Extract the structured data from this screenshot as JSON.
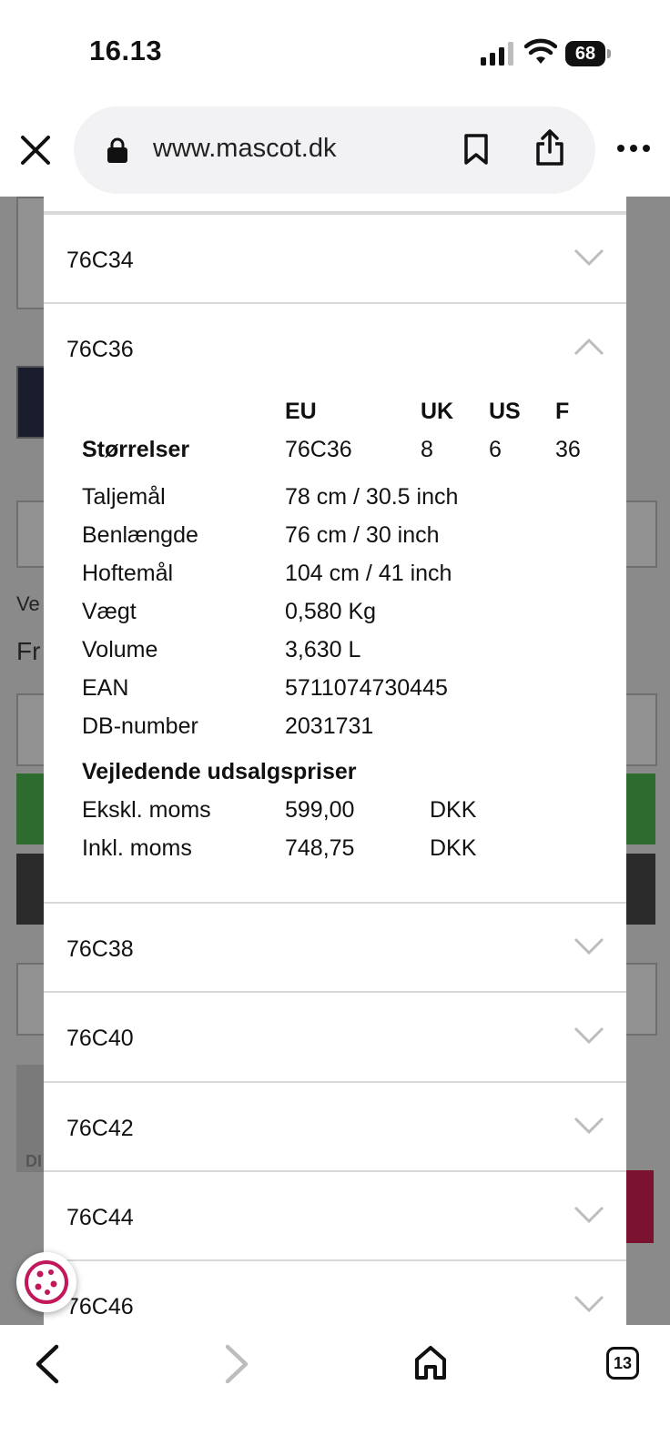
{
  "status_bar": {
    "time": "16.13",
    "battery": "68"
  },
  "browser": {
    "url": "www.mascot.dk",
    "tab_count": "13"
  },
  "accordion_before": [
    {
      "label": "76C34"
    }
  ],
  "expanded": {
    "label": "76C36",
    "headers": {
      "eu": "EU",
      "uk": "UK",
      "us": "US",
      "f": "F"
    },
    "sizes_row": {
      "label": "Størrelser",
      "eu": "76C36",
      "uk": "8",
      "us": "6",
      "f": "36"
    },
    "specs": [
      {
        "label": "Taljemål",
        "value": "78 cm / 30.5 inch"
      },
      {
        "label": "Benlængde",
        "value": "76 cm / 30 inch"
      },
      {
        "label": "Hoftemål",
        "value": "104 cm / 41 inch"
      },
      {
        "label": "Vægt",
        "value": "0,580 Kg"
      },
      {
        "label": "Volume",
        "value": "3,630 L"
      },
      {
        "label": "EAN",
        "value": "5711074730445"
      },
      {
        "label": "DB-number",
        "value": "2031731"
      }
    ],
    "prices_title": "Vejledende udsalgspriser",
    "prices": [
      {
        "label": "Ekskl. moms",
        "value": "599,00",
        "currency": "DKK"
      },
      {
        "label": "Inkl. moms",
        "value": "748,75",
        "currency": "DKK"
      }
    ]
  },
  "accordion_after": [
    {
      "label": "76C38"
    },
    {
      "label": "76C40"
    },
    {
      "label": "76C42"
    },
    {
      "label": "76C44"
    },
    {
      "label": "76C46"
    }
  ],
  "background_page": {
    "fragment_1": "Ve",
    "fragment_2": "Fr",
    "fragment_3": "DI"
  },
  "colors": {
    "accent_green": "#2e6b2e",
    "accent_red": "#7a1230",
    "cookie": "#c2185b"
  }
}
